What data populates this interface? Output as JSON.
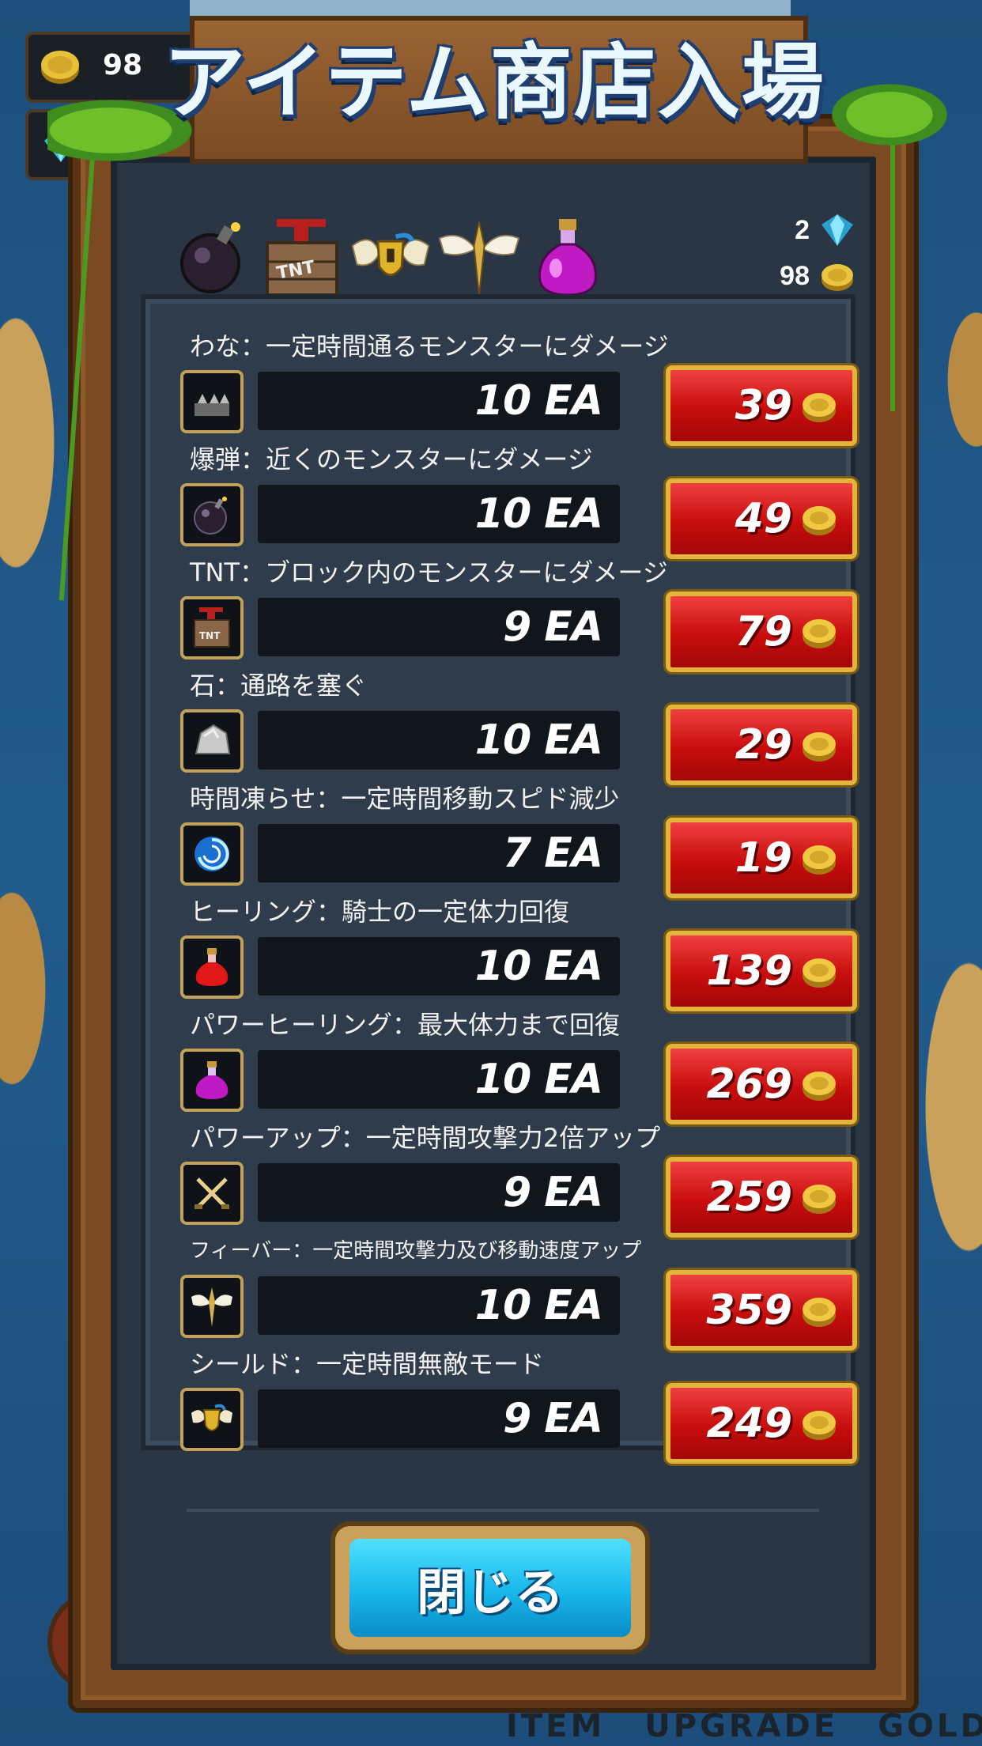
{
  "title": "アイテム商店入場",
  "hud": {
    "coins": "98"
  },
  "currency": {
    "gems": "2",
    "coins": "98"
  },
  "bottom_tabs": [
    "ITEM",
    "UPGRADE",
    "GOLD"
  ],
  "items": [
    {
      "desc": "わな：一定時間通るモンスターにダメージ",
      "qty": "10 EA",
      "price": "39",
      "icon": "trap-icon"
    },
    {
      "desc": "爆弾：近くのモンスターにダメージ",
      "qty": "10 EA",
      "price": "49",
      "icon": "bomb-icon"
    },
    {
      "desc": "TNT：ブロック内のモンスターにダメージ",
      "qty": "9 EA",
      "price": "79",
      "icon": "tnt-icon"
    },
    {
      "desc": "石：通路を塞ぐ",
      "qty": "10 EA",
      "price": "29",
      "icon": "stone-icon"
    },
    {
      "desc": "時間凍らせ：一定時間移動スピド減少",
      "qty": "7 EA",
      "price": "19",
      "icon": "time-freeze-icon"
    },
    {
      "desc": "ヒーリング：騎士の一定体力回復",
      "qty": "10 EA",
      "price": "139",
      "icon": "red-potion-icon"
    },
    {
      "desc": "パワーヒーリング：最大体力まで回復",
      "qty": "10 EA",
      "price": "269",
      "icon": "purple-potion-icon"
    },
    {
      "desc": "パワーアップ：一定時間攻撃力2倍アップ",
      "qty": "9 EA",
      "price": "259",
      "icon": "crossed-swords-icon"
    },
    {
      "desc": "フィーバー：一定時間攻撃力及び移動速度アップ",
      "qty": "10 EA",
      "price": "359",
      "icon": "winged-sword-icon"
    },
    {
      "desc": "シールド：一定時間無敵モード",
      "qty": "9 EA",
      "price": "249",
      "icon": "winged-shield-icon"
    }
  ],
  "close_label": "閉じる",
  "colors": {
    "buy_red": "#c80d0d",
    "gold_border": "#e3b43a",
    "close_cyan": "#18b6ea",
    "panel": "#2f3c4b"
  }
}
